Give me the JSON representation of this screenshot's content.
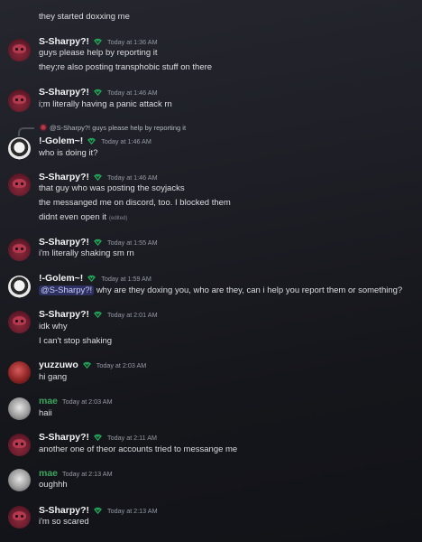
{
  "messages": [
    {
      "type": "continuation",
      "lines": [
        "they started doxxing me"
      ]
    },
    {
      "type": "group",
      "author": "S-Sharpy?!",
      "avatar": "sharpy-avatar",
      "timestamp": "Today at 1:36 AM",
      "lines": [
        "guys please help by reporting it",
        "they;re also posting transphobic stuff on there"
      ]
    },
    {
      "type": "group",
      "author": "S-Sharpy?!",
      "avatar": "sharpy-avatar",
      "timestamp": "Today at 1:46 AM",
      "lines": [
        "i;m literally having a panic attack rn"
      ]
    },
    {
      "type": "reply",
      "reply_to": "@S-Sharpy?! guys please help by reporting it",
      "author": "!-Golem~!",
      "avatar": "golem-avatar",
      "timestamp": "Today at 1:46 AM",
      "lines": [
        "who is doing it?"
      ]
    },
    {
      "type": "group",
      "author": "S-Sharpy?!",
      "avatar": "sharpy-avatar",
      "timestamp": "Today at 1:46 AM",
      "lines": [
        "that guy who was posting the soyjacks",
        "the messanged me on discord, too. I blocked them",
        "didnt even open it"
      ],
      "edited_label": "(edited)"
    },
    {
      "type": "group",
      "author": "S-Sharpy?!",
      "avatar": "sharpy-avatar",
      "timestamp": "Today at 1:55 AM",
      "lines": [
        "i'm literally shaking sm rn"
      ]
    },
    {
      "type": "group",
      "author": "!-Golem~!",
      "avatar": "golem-avatar",
      "timestamp": "Today at 1:59 AM",
      "mention": "@S-Sharpy?!",
      "lines": [
        "why are they doxing you, who are they, can i help you report them or something?"
      ]
    },
    {
      "type": "group",
      "author": "S-Sharpy?!",
      "avatar": "sharpy-avatar",
      "timestamp": "Today at 2:01 AM",
      "lines": [
        "idk why",
        "I can't stop shaking"
      ]
    },
    {
      "type": "group",
      "author": "yuzzuwo",
      "avatar": "yuzzuwo-avatar",
      "timestamp": "Today at 2:03 AM",
      "lines": [
        "hi gang"
      ]
    },
    {
      "type": "group",
      "author": "mae",
      "avatar": "mae-avatar",
      "timestamp": "Today at 2:03 AM",
      "lines": [
        "haii"
      ]
    },
    {
      "type": "group",
      "author": "S-Sharpy?!",
      "avatar": "sharpy-avatar",
      "timestamp": "Today at 2:11 AM",
      "lines": [
        "another one of theor accounts tried to messange me"
      ]
    },
    {
      "type": "group",
      "author": "mae",
      "avatar": "mae-avatar",
      "timestamp": "Today at 2:13 AM",
      "lines": [
        "oughhh"
      ]
    },
    {
      "type": "group",
      "author": "S-Sharpy?!",
      "avatar": "sharpy-avatar",
      "timestamp": "Today at 2:13 AM",
      "lines": [
        "i'm so scared"
      ]
    }
  ],
  "colors": {
    "name_default": "#f2f3f5",
    "name_mae": "#3ba55c",
    "timestamp": "#949ba4",
    "message": "#dbdee1",
    "background": "#1e1f26",
    "mention_bg": "#5865f2"
  },
  "icons": {
    "role_tag": "green-leaf-badge-icon"
  }
}
